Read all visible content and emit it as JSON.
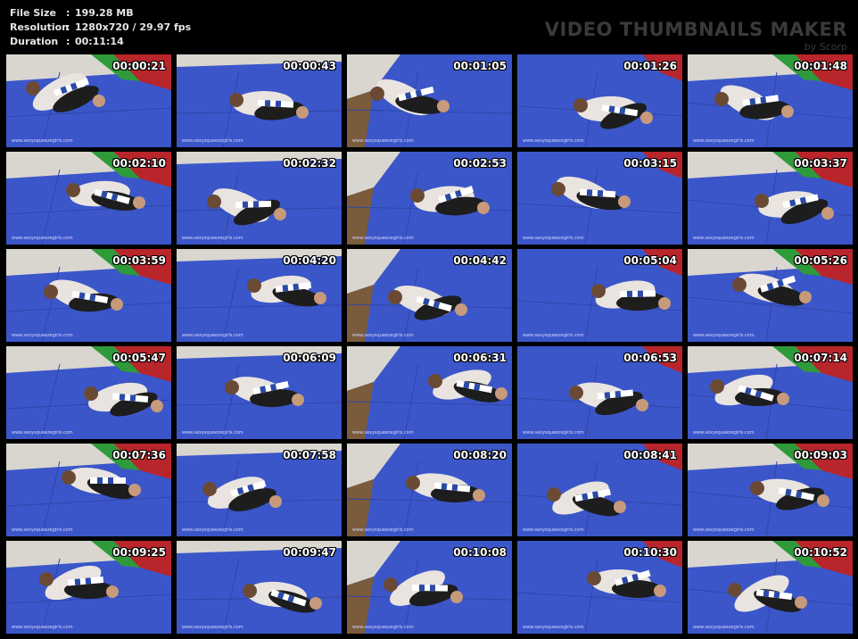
{
  "info": {
    "file_size_label": "File Size",
    "file_size_value": "199.28 MB",
    "resolution_label": "Resolution",
    "resolution_value": "1280x720 / 29.97 fps",
    "duration_label": "Duration",
    "duration_value": "00:11:14",
    "separator": ":"
  },
  "watermark": {
    "title": "VIDEO THUMBNAILS MAKER",
    "subtitle": "by Scorp"
  },
  "site_watermark": "www.sexysqueezegirls.com",
  "timestamps": [
    "00:00:21",
    "00:00:43",
    "00:01:05",
    "00:01:26",
    "00:01:48",
    "00:02:10",
    "00:02:32",
    "00:02:53",
    "00:03:15",
    "00:03:37",
    "00:03:59",
    "00:04:20",
    "00:04:42",
    "00:05:04",
    "00:05:26",
    "00:05:47",
    "00:06:09",
    "00:06:31",
    "00:06:53",
    "00:07:14",
    "00:07:36",
    "00:07:58",
    "00:08:20",
    "00:08:41",
    "00:09:03",
    "00:09:25",
    "00:09:47",
    "00:10:08",
    "00:10:30",
    "00:10:52"
  ],
  "colors": {
    "mat_blue": "#3b56c9",
    "mat_red": "#b8252b",
    "mat_green": "#2e9a3a",
    "wall": "#d9d6cf",
    "floor": "#7a5b3c"
  }
}
